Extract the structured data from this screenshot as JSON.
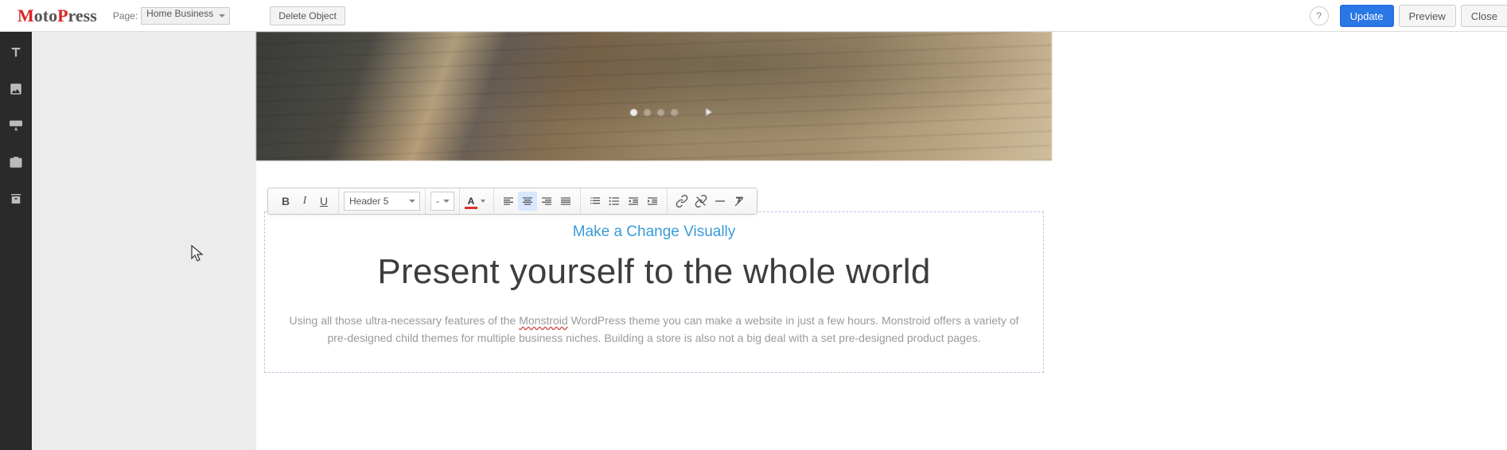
{
  "topbar": {
    "logo_text": "MotoPress",
    "page_label": "Page:",
    "page_name": "Home Business",
    "delete_object": "Delete Object",
    "help_tooltip": "?",
    "update": "Update",
    "preview": "Preview",
    "close": "Close"
  },
  "sidebar": {
    "items": [
      {
        "name": "text-icon"
      },
      {
        "name": "image-icon"
      },
      {
        "name": "button-icon"
      },
      {
        "name": "media-icon"
      },
      {
        "name": "widgets-icon"
      }
    ]
  },
  "hero": {
    "active_slide_index": 0,
    "total_slides": 4
  },
  "rte": {
    "heading_select": "Header 5",
    "font_size_select": "-",
    "text_color": "#d93131",
    "buttons": {
      "bold": "B",
      "italic": "I",
      "underline": "U"
    }
  },
  "content": {
    "subheading": "Make a Change Visually",
    "heading": "Present yourself to the whole world",
    "desc_before": "Using all those ultra-necessary features of the ",
    "desc_spellerr": "Monstroid",
    "desc_after": " WordPress theme you can make a website in just a few hours. Monstroid offers a variety of pre-designed child themes for multiple business niches. Building a store is also not a big deal with a set pre-designed product pages."
  }
}
